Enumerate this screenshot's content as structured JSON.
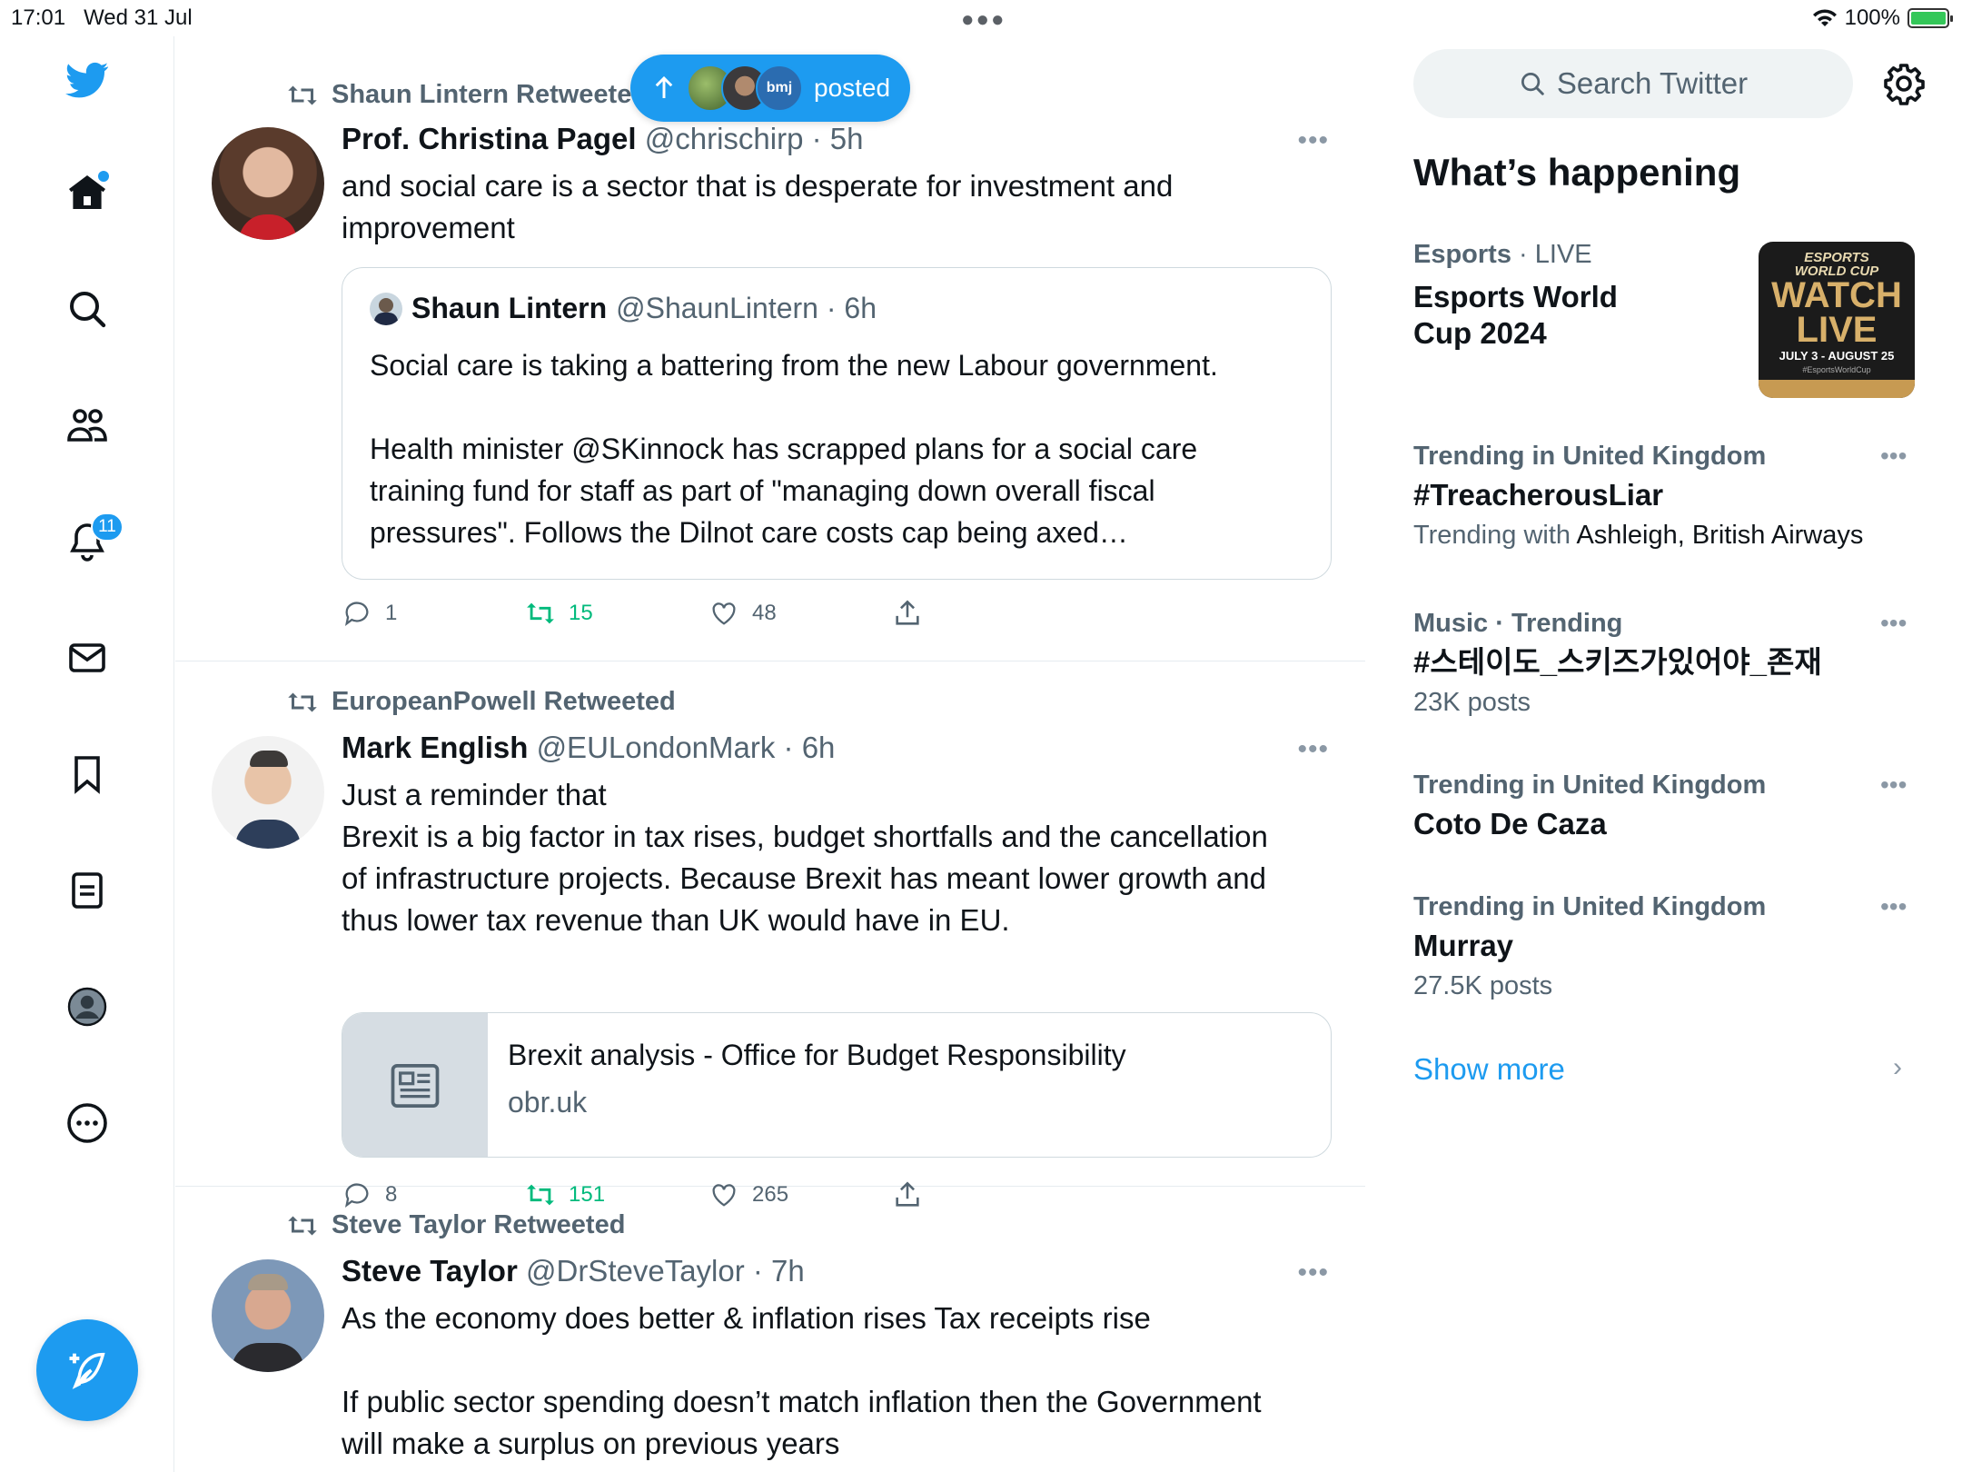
{
  "status_bar": {
    "time": "17:01",
    "date": "Wed 31 Jul",
    "battery": "100%"
  },
  "nav": {
    "notification_count": "11"
  },
  "posted_pill": {
    "label": "posted",
    "avatar2_text": "bmj"
  },
  "tweets": [
    {
      "retweeted_by": "Shaun Lintern Retweeted",
      "name": "Prof. Christina Pagel",
      "handle": "@chrischirp",
      "time": "5h",
      "text": "and social care is a sector that is desperate for investment and\nimprovement",
      "quote": {
        "name": "Shaun Lintern",
        "handle": "@ShaunLintern",
        "time": "6h",
        "text": "Social care is taking a battering from the new Labour government.\n\nHealth minister @SKinnock has scrapped plans for a social care\ntraining fund for staff as part of \"managing down overall fiscal\npressures\". Follows the Dilnot care costs cap being axed…"
      },
      "replies": "1",
      "retweets": "15",
      "likes": "48"
    },
    {
      "retweeted_by": "EuropeanPowell Retweeted",
      "name": "Mark English",
      "handle": "@EULondonMark",
      "time": "6h",
      "text": "Just a reminder that\nBrexit is a big factor in tax rises, budget shortfalls and the cancellation\nof infrastructure projects. Because Brexit has meant lower growth and\nthus lower tax revenue than UK would have in EU.",
      "link": {
        "title": "Brexit analysis - Office for Budget Responsibility",
        "domain": "obr.uk"
      },
      "replies": "8",
      "retweets": "151",
      "likes": "265"
    },
    {
      "retweeted_by": "Steve Taylor Retweeted",
      "name": "Steve Taylor",
      "handle": "@DrSteveTaylor",
      "time": "7h",
      "text": "As the economy does better & inflation rises Tax receipts rise\n\nIf public sector spending doesn’t match inflation then the Government\nwill make a surplus on previous years"
    }
  ],
  "sidebar": {
    "search_placeholder": "Search Twitter",
    "title": "What’s happening",
    "trends": [
      {
        "category": "Esports",
        "category_suffix": " · LIVE",
        "title_line1": "Esports World",
        "title_line2": "Cup 2024"
      },
      {
        "category": "Trending in United Kingdom",
        "title": "#TreacherousLiar",
        "sub_prefix": "Trending with ",
        "sub_names": "Ashleigh, British Airways"
      },
      {
        "category": "Music · Trending",
        "title": "#스테이도_스키즈가있어야_존재",
        "sub": "23K posts"
      },
      {
        "category": "Trending in United Kingdom",
        "title": "Coto De Caza"
      },
      {
        "category": "Trending in United Kingdom",
        "title": "Murray",
        "sub": "27.5K posts"
      }
    ],
    "esports_image": {
      "line1": "ESPORTS",
      "line2": "WORLD CUP",
      "line3": "WATCH",
      "line4": "LIVE",
      "line5": "JULY 3 - AUGUST 25",
      "line6": "#EsportsWorldCup"
    },
    "show_more": "Show more"
  },
  "colors": {
    "accent": "#1d9bf0",
    "retweet_green": "#00ba7c",
    "secondary_text": "#536471"
  }
}
